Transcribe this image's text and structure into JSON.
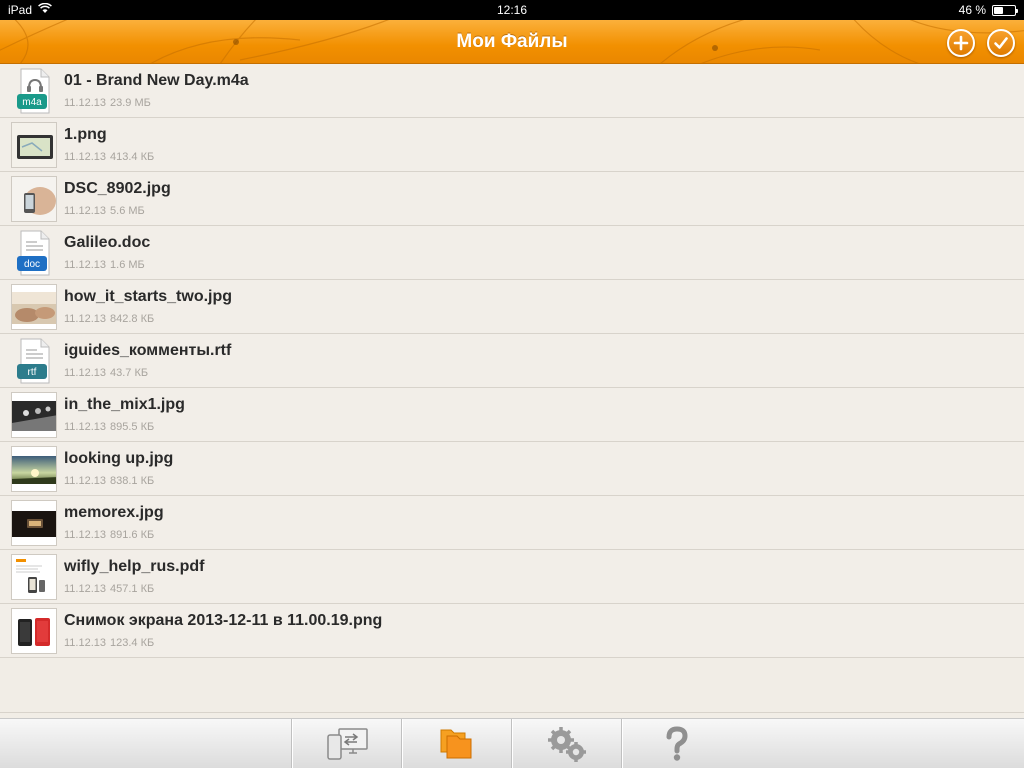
{
  "status_bar": {
    "device": "iPad",
    "time": "12:16",
    "battery": "46 %",
    "battery_level": 0.46
  },
  "nav": {
    "title": "Мои Файлы",
    "add_icon": "plus-icon",
    "done_icon": "checkmark-icon",
    "accent_color": "#f29000"
  },
  "files": [
    {
      "name": "01 - Brand New Day.m4a",
      "date": "11.12.13",
      "size": "23.9 МБ",
      "thumb": "m4a-icon"
    },
    {
      "name": "1.png",
      "date": "11.12.13",
      "size": "413.4 КБ",
      "thumb": "image-thumbnail"
    },
    {
      "name": "DSC_8902.jpg",
      "date": "11.12.13",
      "size": "5.6 МБ",
      "thumb": "image-thumbnail"
    },
    {
      "name": "Galileo.doc",
      "date": "11.12.13",
      "size": "1.6 МБ",
      "thumb": "doc-icon"
    },
    {
      "name": "how_it_starts_two.jpg",
      "date": "11.12.13",
      "size": "842.8 КБ",
      "thumb": "image-thumbnail"
    },
    {
      "name": "iguides_комменты.rtf",
      "date": "11.12.13",
      "size": "43.7 КБ",
      "thumb": "rtf-icon"
    },
    {
      "name": "in_the_mix1.jpg",
      "date": "11.12.13",
      "size": "895.5 КБ",
      "thumb": "image-thumbnail"
    },
    {
      "name": "looking up.jpg",
      "date": "11.12.13",
      "size": "838.1 КБ",
      "thumb": "image-thumbnail"
    },
    {
      "name": "memorex.jpg",
      "date": "11.12.13",
      "size": "891.6 КБ",
      "thumb": "image-thumbnail"
    },
    {
      "name": "wifly_help_rus.pdf",
      "date": "11.12.13",
      "size": "457.1 КБ",
      "thumb": "pdf-thumbnail"
    },
    {
      "name": "Снимок экрана 2013-12-11 в 11.00.19.png",
      "date": "11.12.13",
      "size": "123.4 КБ",
      "thumb": "image-thumbnail"
    }
  ],
  "file_type_labels": {
    "m4a": "m4a",
    "doc": "doc",
    "rtf": "rtf"
  },
  "tab_bar": [
    {
      "icon": "transfer-icon",
      "active": false
    },
    {
      "icon": "files-icon",
      "active": true
    },
    {
      "icon": "settings-icon",
      "active": false
    },
    {
      "icon": "help-icon",
      "active": false
    }
  ]
}
